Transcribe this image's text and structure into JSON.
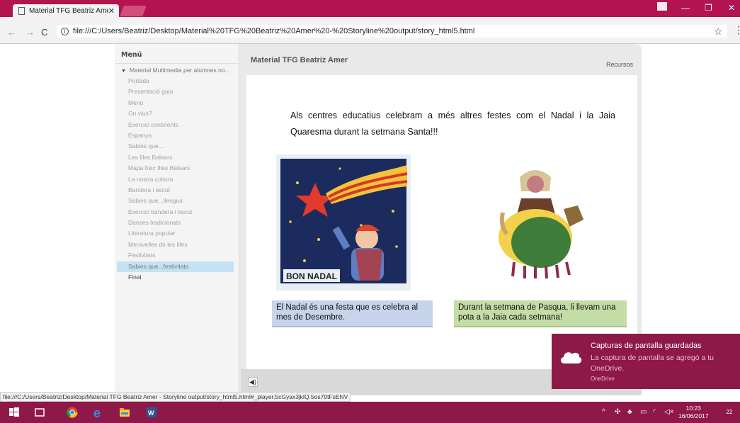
{
  "browser": {
    "tab_title": "Material TFG Beatriz Ame",
    "tab_close": "✕",
    "url": "file:///C:/Users/Beatriz/Desktop/Material%20TFG%20Beatriz%20Amer%20-%20Storyline%20output/story_html5.html",
    "status_url": "file:///C:/Users/Beatriz/Desktop/Material TFG Beatriz Amer - Storyline output/story_html5.html#_player.5cGyax3jklQ.5os70tFsENV"
  },
  "player": {
    "menu_title": "Menú",
    "menu_root": "Material Multimedia per alumnes no...",
    "menu_items": [
      "Portada",
      "Presentació guia",
      "Menú",
      "On vius?",
      "Exercici continents",
      "Espanya",
      "Sabies que...",
      "Les Illes Balears",
      "Mapa físic Illes Balears",
      "La nostra cultura",
      "Bandera i escut",
      "Sabies que...llengua",
      "Exercici bandera i escut",
      "Danses tradicionals",
      "Literatura popular",
      "Meravelles de les Illes",
      "Festivitats",
      "Sabies que...festivitats",
      "Final"
    ],
    "active_item": "Sabies que...festivitats",
    "course_title": "Material TFG Beatriz Amer",
    "resources_label": "Recursos"
  },
  "slide": {
    "text": "Als centres educatius celebram a més altres festes com el Nadal i la Jaia Quaresma durant la setmana Santa!!!",
    "image1_caption": "BON NADAL !",
    "caption_left": "El Nadal és una festa que es celebra al mes de Desembre.",
    "caption_right": "Durant la setmana de Pasqua, li llevam una pota a la Jaia cada setmana!"
  },
  "toast": {
    "title": "Capturas de pantalla guardadas",
    "body": "La captura de pantalla se agregó a tu OneDrive.",
    "app": "OneDrive"
  },
  "taskbar": {
    "time": "10:23",
    "date": "16/06/2017",
    "notifications": "22"
  },
  "colors": {
    "accent": "#b3134f",
    "taskbar": "#8e1848",
    "caption_blue": "#c6d5ec",
    "caption_green": "#c4dca6"
  }
}
